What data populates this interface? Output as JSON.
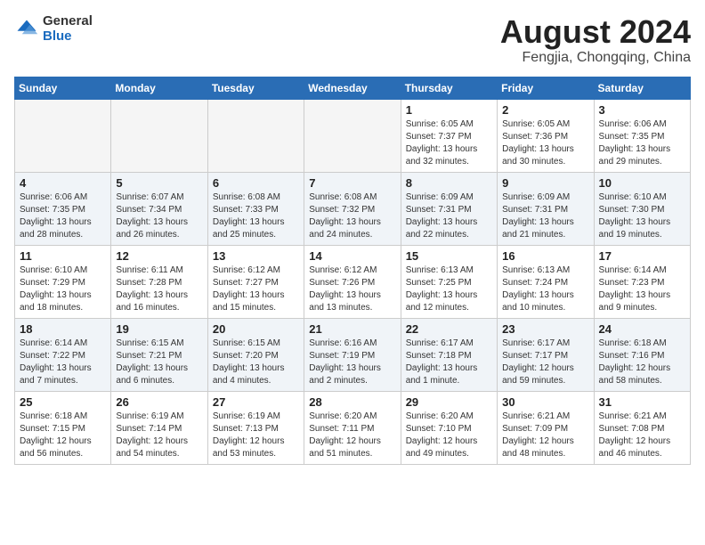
{
  "header": {
    "logo_general": "General",
    "logo_blue": "Blue",
    "month_title": "August 2024",
    "location": "Fengjia, Chongqing, China"
  },
  "weekdays": [
    "Sunday",
    "Monday",
    "Tuesday",
    "Wednesday",
    "Thursday",
    "Friday",
    "Saturday"
  ],
  "weeks": [
    [
      {
        "day": "",
        "info": ""
      },
      {
        "day": "",
        "info": ""
      },
      {
        "day": "",
        "info": ""
      },
      {
        "day": "",
        "info": ""
      },
      {
        "day": "1",
        "info": "Sunrise: 6:05 AM\nSunset: 7:37 PM\nDaylight: 13 hours\nand 32 minutes."
      },
      {
        "day": "2",
        "info": "Sunrise: 6:05 AM\nSunset: 7:36 PM\nDaylight: 13 hours\nand 30 minutes."
      },
      {
        "day": "3",
        "info": "Sunrise: 6:06 AM\nSunset: 7:35 PM\nDaylight: 13 hours\nand 29 minutes."
      }
    ],
    [
      {
        "day": "4",
        "info": "Sunrise: 6:06 AM\nSunset: 7:35 PM\nDaylight: 13 hours\nand 28 minutes."
      },
      {
        "day": "5",
        "info": "Sunrise: 6:07 AM\nSunset: 7:34 PM\nDaylight: 13 hours\nand 26 minutes."
      },
      {
        "day": "6",
        "info": "Sunrise: 6:08 AM\nSunset: 7:33 PM\nDaylight: 13 hours\nand 25 minutes."
      },
      {
        "day": "7",
        "info": "Sunrise: 6:08 AM\nSunset: 7:32 PM\nDaylight: 13 hours\nand 24 minutes."
      },
      {
        "day": "8",
        "info": "Sunrise: 6:09 AM\nSunset: 7:31 PM\nDaylight: 13 hours\nand 22 minutes."
      },
      {
        "day": "9",
        "info": "Sunrise: 6:09 AM\nSunset: 7:31 PM\nDaylight: 13 hours\nand 21 minutes."
      },
      {
        "day": "10",
        "info": "Sunrise: 6:10 AM\nSunset: 7:30 PM\nDaylight: 13 hours\nand 19 minutes."
      }
    ],
    [
      {
        "day": "11",
        "info": "Sunrise: 6:10 AM\nSunset: 7:29 PM\nDaylight: 13 hours\nand 18 minutes."
      },
      {
        "day": "12",
        "info": "Sunrise: 6:11 AM\nSunset: 7:28 PM\nDaylight: 13 hours\nand 16 minutes."
      },
      {
        "day": "13",
        "info": "Sunrise: 6:12 AM\nSunset: 7:27 PM\nDaylight: 13 hours\nand 15 minutes."
      },
      {
        "day": "14",
        "info": "Sunrise: 6:12 AM\nSunset: 7:26 PM\nDaylight: 13 hours\nand 13 minutes."
      },
      {
        "day": "15",
        "info": "Sunrise: 6:13 AM\nSunset: 7:25 PM\nDaylight: 13 hours\nand 12 minutes."
      },
      {
        "day": "16",
        "info": "Sunrise: 6:13 AM\nSunset: 7:24 PM\nDaylight: 13 hours\nand 10 minutes."
      },
      {
        "day": "17",
        "info": "Sunrise: 6:14 AM\nSunset: 7:23 PM\nDaylight: 13 hours\nand 9 minutes."
      }
    ],
    [
      {
        "day": "18",
        "info": "Sunrise: 6:14 AM\nSunset: 7:22 PM\nDaylight: 13 hours\nand 7 minutes."
      },
      {
        "day": "19",
        "info": "Sunrise: 6:15 AM\nSunset: 7:21 PM\nDaylight: 13 hours\nand 6 minutes."
      },
      {
        "day": "20",
        "info": "Sunrise: 6:15 AM\nSunset: 7:20 PM\nDaylight: 13 hours\nand 4 minutes."
      },
      {
        "day": "21",
        "info": "Sunrise: 6:16 AM\nSunset: 7:19 PM\nDaylight: 13 hours\nand 2 minutes."
      },
      {
        "day": "22",
        "info": "Sunrise: 6:17 AM\nSunset: 7:18 PM\nDaylight: 13 hours\nand 1 minute."
      },
      {
        "day": "23",
        "info": "Sunrise: 6:17 AM\nSunset: 7:17 PM\nDaylight: 12 hours\nand 59 minutes."
      },
      {
        "day": "24",
        "info": "Sunrise: 6:18 AM\nSunset: 7:16 PM\nDaylight: 12 hours\nand 58 minutes."
      }
    ],
    [
      {
        "day": "25",
        "info": "Sunrise: 6:18 AM\nSunset: 7:15 PM\nDaylight: 12 hours\nand 56 minutes."
      },
      {
        "day": "26",
        "info": "Sunrise: 6:19 AM\nSunset: 7:14 PM\nDaylight: 12 hours\nand 54 minutes."
      },
      {
        "day": "27",
        "info": "Sunrise: 6:19 AM\nSunset: 7:13 PM\nDaylight: 12 hours\nand 53 minutes."
      },
      {
        "day": "28",
        "info": "Sunrise: 6:20 AM\nSunset: 7:11 PM\nDaylight: 12 hours\nand 51 minutes."
      },
      {
        "day": "29",
        "info": "Sunrise: 6:20 AM\nSunset: 7:10 PM\nDaylight: 12 hours\nand 49 minutes."
      },
      {
        "day": "30",
        "info": "Sunrise: 6:21 AM\nSunset: 7:09 PM\nDaylight: 12 hours\nand 48 minutes."
      },
      {
        "day": "31",
        "info": "Sunrise: 6:21 AM\nSunset: 7:08 PM\nDaylight: 12 hours\nand 46 minutes."
      }
    ]
  ]
}
